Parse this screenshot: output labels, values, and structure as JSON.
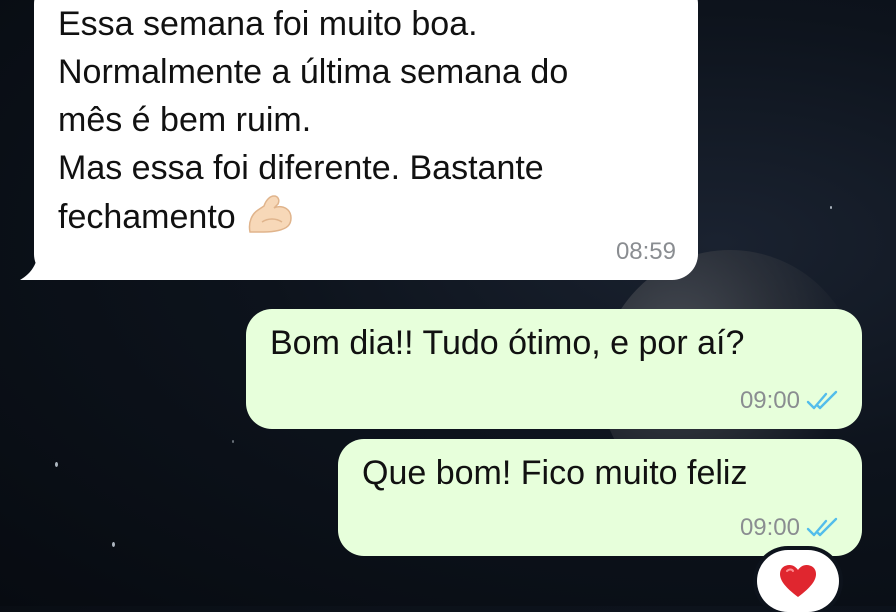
{
  "messages": [
    {
      "id": "msg-1",
      "direction": "incoming",
      "text": "Essa semana foi muito boa.\nNormalmente a última semana do\nmês é bem ruim.\nMas essa foi diferente. Bastante\nfechamento",
      "emoji": "flexed-biceps",
      "time": "08:59"
    },
    {
      "id": "msg-2",
      "direction": "outgoing",
      "text": "Bom dia!! Tudo ótimo, e por aí?",
      "time": "09:00",
      "status": "read-double-check"
    },
    {
      "id": "msg-3",
      "direction": "outgoing",
      "text": "Que bom! Fico muito feliz",
      "time": "09:00",
      "status": "read-double-check",
      "reaction": "red-heart"
    }
  ],
  "colors": {
    "incoming_bubble": "#ffffff",
    "outgoing_bubble": "#e7ffdb",
    "read_ticks": "#53bdeb",
    "timestamp": "#8a8d91",
    "wallpaper": "#0d131c",
    "heart": "#e0262f"
  }
}
